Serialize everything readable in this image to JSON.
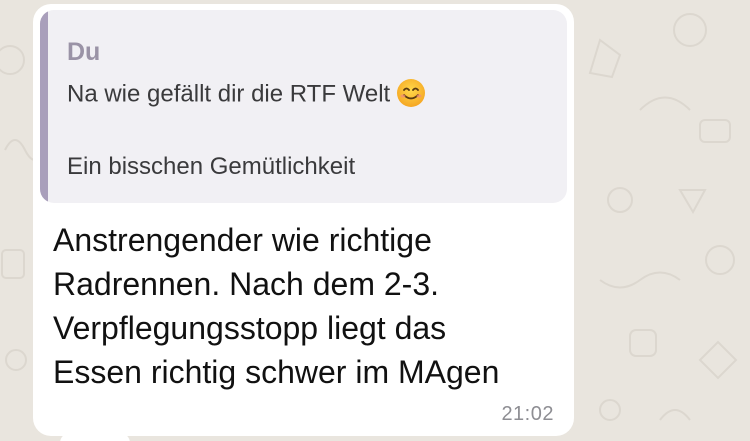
{
  "quoted_message": {
    "sender": "Du",
    "text": "Na wie gefällt dir die RTF Welt",
    "emoji_name": "smiling-face-emoji",
    "reply": "Ein bisschen Gemütlichkeit"
  },
  "message": {
    "lines": [
      "Anstrengender wie richtige",
      "Radrennen. Nach dem 2-3.",
      "Verpflegungsstopp liegt das",
      "Essen richtig schwer im MAgen"
    ],
    "time": "21:02"
  },
  "colors": {
    "wallpaper": "#e9e5de",
    "bubble": "#ffffff",
    "quote_background": "#f1f0f4",
    "quote_bar": "#a99fbb",
    "quote_sender": "#9a93a6"
  }
}
